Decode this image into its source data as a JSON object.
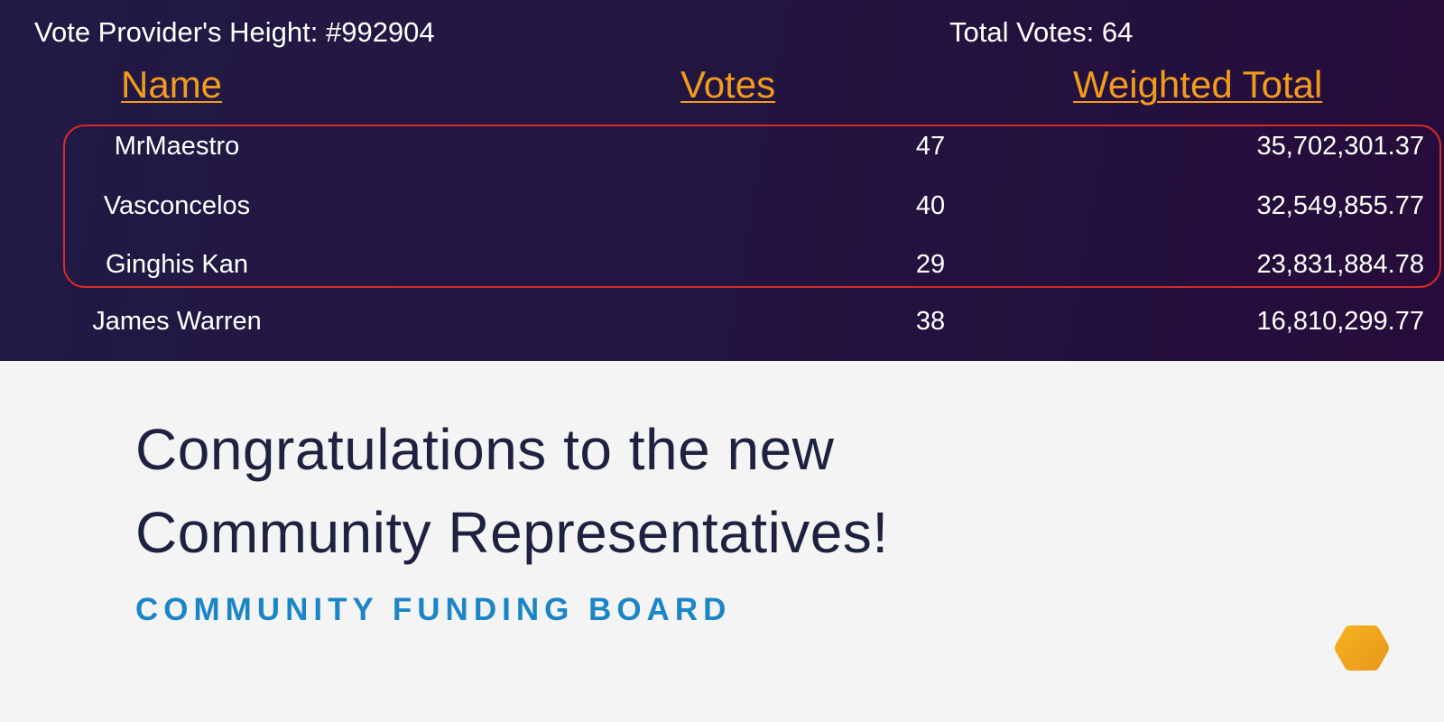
{
  "top_panel": {
    "provider_height": "Vote Provider's Height: #992904",
    "total_votes": "Total Votes: 64",
    "columns": {
      "name": "Name",
      "votes": "Votes",
      "weighted_total": "Weighted Total"
    },
    "rows": [
      {
        "name": "MrMaestro",
        "votes": "47",
        "weighted_total": "35,702,301.37",
        "highlighted": true
      },
      {
        "name": "Vasconcelos",
        "votes": "40",
        "weighted_total": "32,549,855.77",
        "highlighted": true
      },
      {
        "name": "Ginghis Kan",
        "votes": "29",
        "weighted_total": "23,831,884.78",
        "highlighted": true
      },
      {
        "name": "James Warren",
        "votes": "38",
        "weighted_total": "16,810,299.77",
        "highlighted": false
      }
    ],
    "colors": {
      "background_start": "#211a45",
      "background_end": "#260c3a",
      "header_link": "#f39c1c",
      "highlight_border": "#d62a2a"
    }
  },
  "announcement": {
    "line1": "Congratulations to the new",
    "line2": "Community Representatives!",
    "org": "COMMUNITY FUNDING BOARD",
    "colors": {
      "headline": "#1e2240",
      "org": "#1a86c8",
      "logo": "#f0a818"
    }
  },
  "logo_icon": "hexagon-icon"
}
